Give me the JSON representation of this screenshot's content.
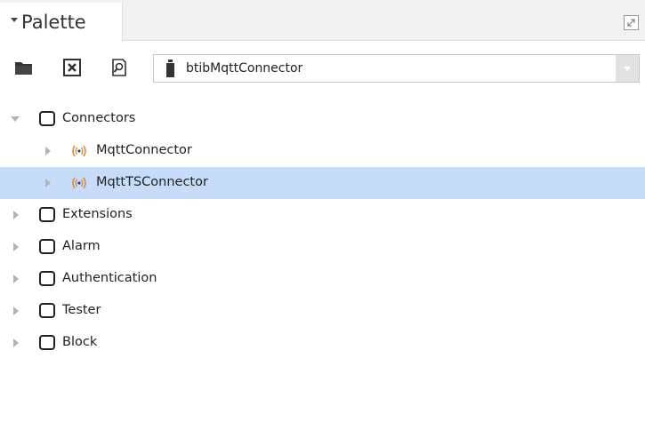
{
  "palette": {
    "title": "Palette",
    "toolbar": {
      "module_value": "btibMqttConnector"
    },
    "tree": [
      {
        "label": "Connectors",
        "expanded": true,
        "level": 0,
        "icon": "folder-icon",
        "selected": false
      },
      {
        "label": "MqttConnector",
        "expanded": false,
        "level": 1,
        "icon": "signal-icon",
        "selected": false
      },
      {
        "label": "MqttTSConnector",
        "expanded": false,
        "level": 1,
        "icon": "signal-icon",
        "selected": true
      },
      {
        "label": "Extensions",
        "expanded": false,
        "level": 0,
        "icon": "folder-icon",
        "selected": false
      },
      {
        "label": "Alarm",
        "expanded": false,
        "level": 0,
        "icon": "folder-icon",
        "selected": false
      },
      {
        "label": "Authentication",
        "expanded": false,
        "level": 0,
        "icon": "folder-icon",
        "selected": false
      },
      {
        "label": "Tester",
        "expanded": false,
        "level": 0,
        "icon": "folder-icon",
        "selected": false
      },
      {
        "label": "Block",
        "expanded": false,
        "level": 0,
        "icon": "folder-icon",
        "selected": false
      }
    ]
  },
  "colors": {
    "selection": "#c7dcf8",
    "signal_icon": "#d98a2b"
  }
}
